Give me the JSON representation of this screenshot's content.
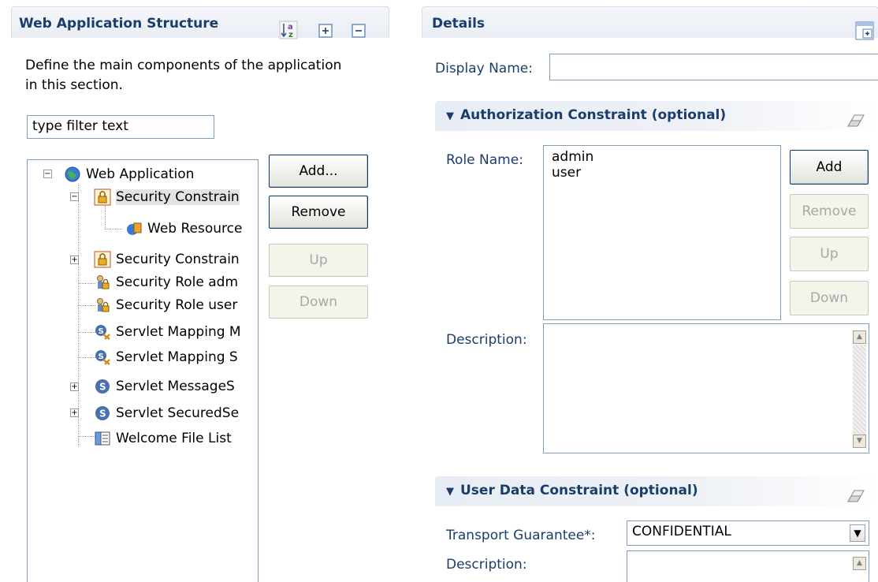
{
  "left_panel": {
    "title": "Web Application Structure",
    "description_line1": "Define the main components of the application",
    "description_line2": "in this section.",
    "filter_placeholder": "type filter text",
    "buttons": {
      "add": "Add...",
      "remove": "Remove",
      "up": "Up",
      "down": "Down"
    },
    "tree": [
      {
        "label": "Web Application",
        "icon": "globe-icon"
      },
      {
        "label": "Security Constrain",
        "icon": "lock-icon"
      },
      {
        "label": "Web Resource",
        "icon": "web-resource-icon"
      },
      {
        "label": "Security Constrain",
        "icon": "lock-icon"
      },
      {
        "label": "Security Role adm",
        "icon": "security-role-icon"
      },
      {
        "label": "Security Role user",
        "icon": "security-role-icon"
      },
      {
        "label": "Servlet Mapping M",
        "icon": "servlet-mapping-icon"
      },
      {
        "label": "Servlet Mapping S",
        "icon": "servlet-mapping-icon"
      },
      {
        "label": "Servlet MessageS",
        "icon": "servlet-icon"
      },
      {
        "label": "Servlet SecuredSe",
        "icon": "servlet-icon"
      },
      {
        "label": "Welcome File List",
        "icon": "welcome-file-icon"
      }
    ]
  },
  "right_panel": {
    "title": "Details",
    "display_name_label": "Display Name:",
    "display_name_value": "",
    "auth_section": {
      "title": "Authorization Constraint (optional)",
      "role_name_label": "Role Name:",
      "roles": [
        "admin",
        "user"
      ],
      "description_label": "Description:",
      "buttons": {
        "add": "Add",
        "remove": "Remove",
        "up": "Up",
        "down": "Down"
      }
    },
    "user_data_section": {
      "title": "User Data Constraint (optional)",
      "transport_label": "Transport Guarantee*:",
      "transport_value": "CONFIDENTIAL",
      "description_label": "Description:",
      "description_value": ""
    }
  },
  "colors": {
    "section_title": "#1a3d6b",
    "border": "#7f9db9",
    "selection": "#e3e3e3"
  }
}
